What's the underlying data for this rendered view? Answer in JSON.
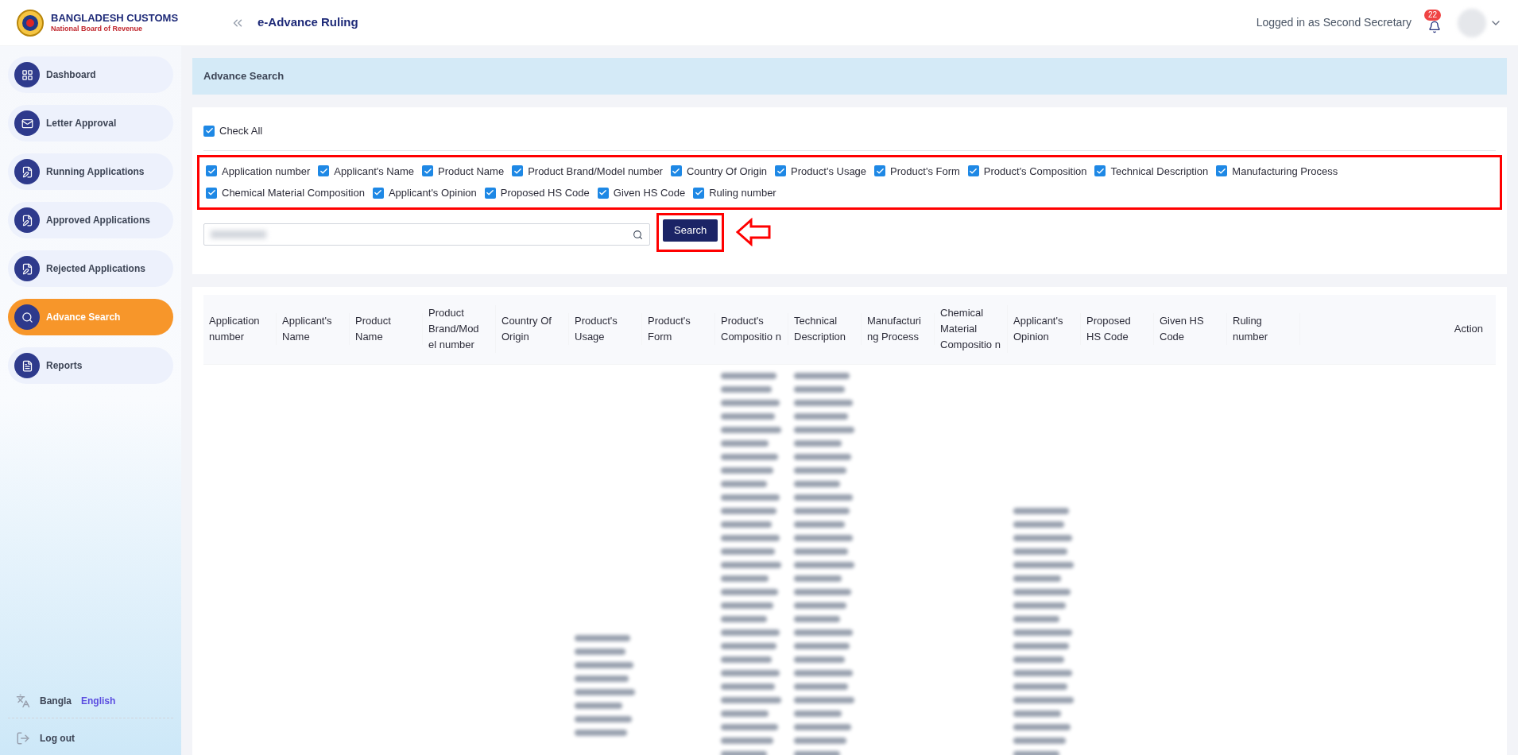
{
  "header": {
    "logo_title": "BANGLADESH CUSTOMS",
    "logo_subtitle": "National Board of Revenue",
    "app_title": "e-Advance Ruling",
    "user_status": "Logged in as Second Secretary",
    "notification_count": "22"
  },
  "sidebar": {
    "items": [
      {
        "label": "Dashboard",
        "selected": false
      },
      {
        "label": "Letter Approval",
        "selected": false
      },
      {
        "label": "Running Applications",
        "selected": false
      },
      {
        "label": "Approved Applications",
        "selected": false
      },
      {
        "label": "Rejected Applications",
        "selected": false
      },
      {
        "label": "Advance Search",
        "selected": true
      },
      {
        "label": "Reports",
        "selected": false
      }
    ],
    "languages": [
      {
        "label": "Bangla",
        "selected": false
      },
      {
        "label": "English",
        "selected": true
      }
    ],
    "logout": "Log out"
  },
  "panel_title": "Advance Search",
  "check_all": {
    "label": "Check All",
    "checked": true
  },
  "fields": [
    {
      "label": "Application number",
      "checked": true
    },
    {
      "label": "Applicant's Name",
      "checked": true
    },
    {
      "label": "Product Name",
      "checked": true
    },
    {
      "label": "Product Brand/Model number",
      "checked": true
    },
    {
      "label": "Country Of Origin",
      "checked": true
    },
    {
      "label": "Product's Usage",
      "checked": true
    },
    {
      "label": "Product's Form",
      "checked": true
    },
    {
      "label": "Product's Composition",
      "checked": true
    },
    {
      "label": "Technical Description",
      "checked": true
    },
    {
      "label": "Manufacturing Process",
      "checked": true
    },
    {
      "label": "Chemical Material Composition",
      "checked": true
    },
    {
      "label": "Applicant's Opinion",
      "checked": true
    },
    {
      "label": "Proposed HS Code",
      "checked": true
    },
    {
      "label": "Given HS Code",
      "checked": true
    },
    {
      "label": "Ruling number",
      "checked": true
    }
  ],
  "search_button": "Search",
  "table": {
    "columns": [
      "Application number",
      "Applicant's Name",
      "Product Name",
      "Product Brand/Mod el number",
      "Country Of Origin",
      "Product's Usage",
      "Product's Form",
      "Product's Compositio n",
      "Technical Description",
      "Manufacturi ng Process",
      "Chemical Material Compositio n",
      "Applicant's Opinion",
      "Proposed HS Code",
      "Given HS Code",
      "Ruling number"
    ],
    "action_column": "Action"
  }
}
